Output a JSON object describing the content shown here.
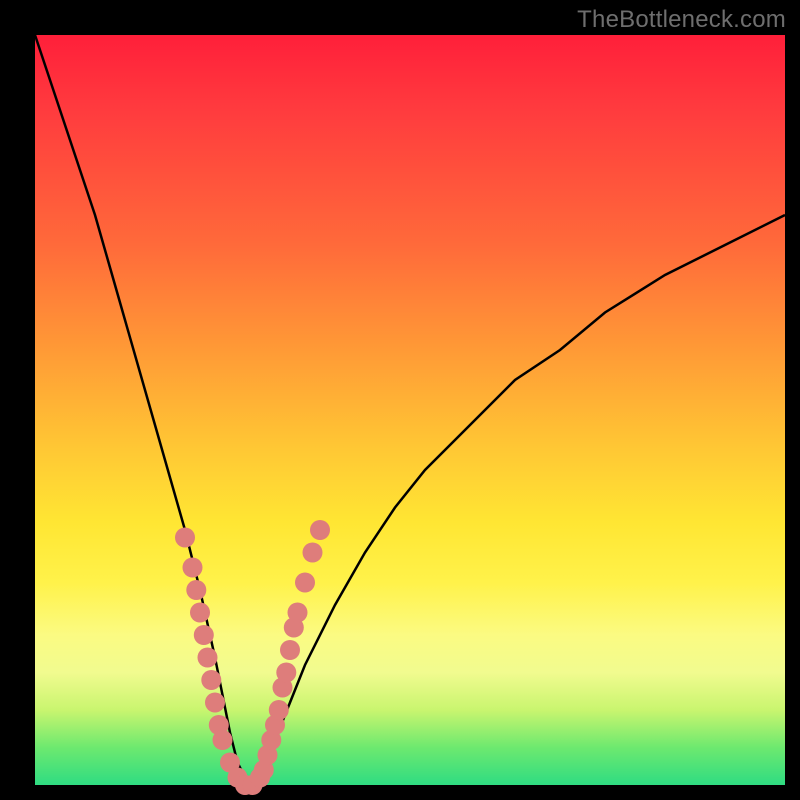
{
  "watermark": "TheBottleneck.com",
  "colors": {
    "background": "#000000",
    "curve_stroke": "#000000",
    "marker_fill": "#de7d7b",
    "marker_stroke": "#b25a59"
  },
  "chart_data": {
    "type": "line",
    "title": "",
    "xlabel": "",
    "ylabel": "",
    "xlim": [
      0,
      100
    ],
    "ylim": [
      0,
      100
    ],
    "grid": false,
    "legend": false,
    "description": "V-shaped bottleneck curve; value falls from ~100 at left to ~0 at x≈27 then rises (concave) toward ~76 at right.",
    "x": [
      0,
      2,
      4,
      6,
      8,
      10,
      12,
      14,
      16,
      18,
      20,
      22,
      24,
      25,
      26,
      27,
      28,
      29,
      30,
      31,
      32,
      34,
      36,
      40,
      44,
      48,
      52,
      56,
      60,
      64,
      70,
      76,
      84,
      92,
      100
    ],
    "values": [
      100,
      94,
      88,
      82,
      76,
      69,
      62,
      55,
      48,
      41,
      34,
      26,
      17,
      12,
      7,
      3,
      1,
      0,
      1,
      3,
      6,
      11,
      16,
      24,
      31,
      37,
      42,
      46,
      50,
      54,
      58,
      63,
      68,
      72,
      76
    ],
    "markers": {
      "description": "salmon circular markers clustered near the trough and a bit up either arm",
      "points": [
        {
          "x": 20,
          "y": 33
        },
        {
          "x": 21,
          "y": 29
        },
        {
          "x": 21.5,
          "y": 26
        },
        {
          "x": 22,
          "y": 23
        },
        {
          "x": 22.5,
          "y": 20
        },
        {
          "x": 23,
          "y": 17
        },
        {
          "x": 23.5,
          "y": 14
        },
        {
          "x": 24,
          "y": 11
        },
        {
          "x": 24.5,
          "y": 8
        },
        {
          "x": 25,
          "y": 6
        },
        {
          "x": 26,
          "y": 3
        },
        {
          "x": 27,
          "y": 1
        },
        {
          "x": 28,
          "y": 0
        },
        {
          "x": 29,
          "y": 0
        },
        {
          "x": 30,
          "y": 1
        },
        {
          "x": 30.5,
          "y": 2
        },
        {
          "x": 31,
          "y": 4
        },
        {
          "x": 31.5,
          "y": 6
        },
        {
          "x": 32,
          "y": 8
        },
        {
          "x": 32.5,
          "y": 10
        },
        {
          "x": 33,
          "y": 13
        },
        {
          "x": 33.5,
          "y": 15
        },
        {
          "x": 34,
          "y": 18
        },
        {
          "x": 34.5,
          "y": 21
        },
        {
          "x": 35,
          "y": 23
        },
        {
          "x": 36,
          "y": 27
        },
        {
          "x": 37,
          "y": 31
        },
        {
          "x": 38,
          "y": 34
        }
      ]
    }
  }
}
